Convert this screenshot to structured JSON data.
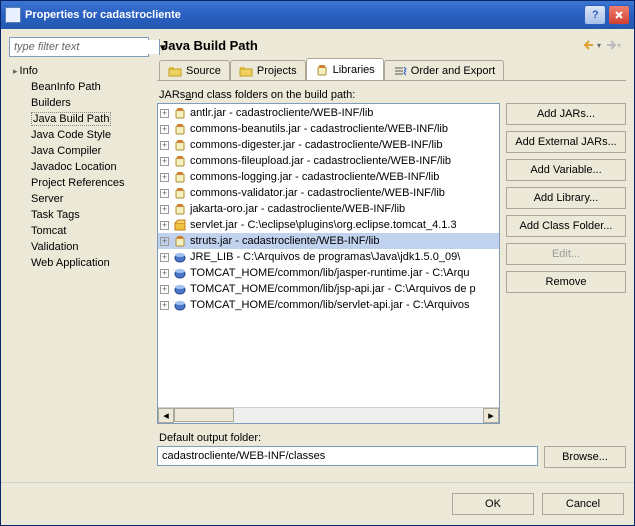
{
  "title": "Properties for cadastrocliente",
  "filter_placeholder": "type filter text",
  "tree": {
    "root": "Info",
    "items": [
      "BeanInfo Path",
      "Builders",
      "Java Build Path",
      "Java Code Style",
      "Java Compiler",
      "Javadoc Location",
      "Project References",
      "Server",
      "Task Tags",
      "Tomcat",
      "Validation",
      "Web Application"
    ],
    "selected": 2
  },
  "page_heading": "Java Build Path",
  "tabs": [
    {
      "label": "Source",
      "icon": "folder"
    },
    {
      "label": "Projects",
      "icon": "folder"
    },
    {
      "label": "Libraries",
      "icon": "jar"
    },
    {
      "label": "Order and Export",
      "icon": "order"
    }
  ],
  "active_tab": 2,
  "list_label_pre": "JARs ",
  "list_label_u": "a",
  "list_label_post": "nd class folders on the build path:",
  "jars": [
    {
      "icon": "jar",
      "text": "antlr.jar - cadastrocliente/WEB-INF/lib"
    },
    {
      "icon": "jar",
      "text": "commons-beanutils.jar - cadastrocliente/WEB-INF/lib"
    },
    {
      "icon": "jar",
      "text": "commons-digester.jar - cadastrocliente/WEB-INF/lib"
    },
    {
      "icon": "jar",
      "text": "commons-fileupload.jar - cadastrocliente/WEB-INF/lib"
    },
    {
      "icon": "jar",
      "text": "commons-logging.jar - cadastrocliente/WEB-INF/lib"
    },
    {
      "icon": "jar",
      "text": "commons-validator.jar - cadastrocliente/WEB-INF/lib"
    },
    {
      "icon": "jar",
      "text": "jakarta-oro.jar - cadastrocliente/WEB-INF/lib"
    },
    {
      "icon": "pkg",
      "text": "servlet.jar - C:\\eclipse\\plugins\\org.eclipse.tomcat_4.1.3"
    },
    {
      "icon": "jar",
      "text": "struts.jar - cadastrocliente/WEB-INF/lib",
      "sel": true
    },
    {
      "icon": "jarblue",
      "text": "JRE_LIB - C:\\Arquivos de programas\\Java\\jdk1.5.0_09\\"
    },
    {
      "icon": "jarblue",
      "text": "TOMCAT_HOME/common/lib/jasper-runtime.jar - C:\\Arqu"
    },
    {
      "icon": "jarblue",
      "text": "TOMCAT_HOME/common/lib/jsp-api.jar - C:\\Arquivos de p"
    },
    {
      "icon": "jarblue",
      "text": "TOMCAT_HOME/common/lib/servlet-api.jar - C:\\Arquivos"
    }
  ],
  "buttons": {
    "add_jars": "Add JARs...",
    "add_ext": "Add External JARs...",
    "add_var": "Add Variable...",
    "add_lib": "Add Library...",
    "add_cf": "Add Class Folder...",
    "edit": "Edit...",
    "remove": "Remove"
  },
  "output_label": "Default output folder:",
  "output_value": "cadastrocliente/WEB-INF/classes",
  "browse": "Browse...",
  "ok": "OK",
  "cancel": "Cancel"
}
